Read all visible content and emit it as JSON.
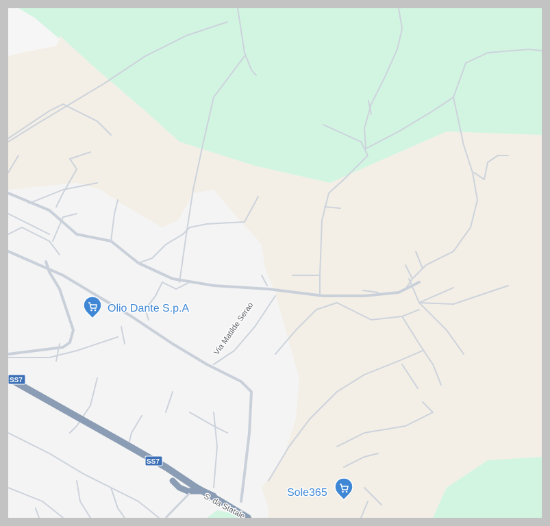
{
  "map": {
    "colors": {
      "background": "#f4f4f4",
      "forest": "#d2f5e2",
      "rural": "#f3efe6",
      "minor_road": "#cdd3dc",
      "highway": "#8b9db4",
      "shield": "#3c6fb5",
      "poi": "#3f87d4"
    },
    "pois": [
      {
        "name": "Olio Dante S.p.A",
        "icon": "shopping-cart-icon"
      },
      {
        "name": "Sole365",
        "icon": "shopping-cart-icon"
      }
    ],
    "roads": {
      "via_label": "Via Matilde Serao",
      "statale_label": "S. da Statale"
    },
    "shields": [
      "SS7",
      "SS7"
    ]
  }
}
